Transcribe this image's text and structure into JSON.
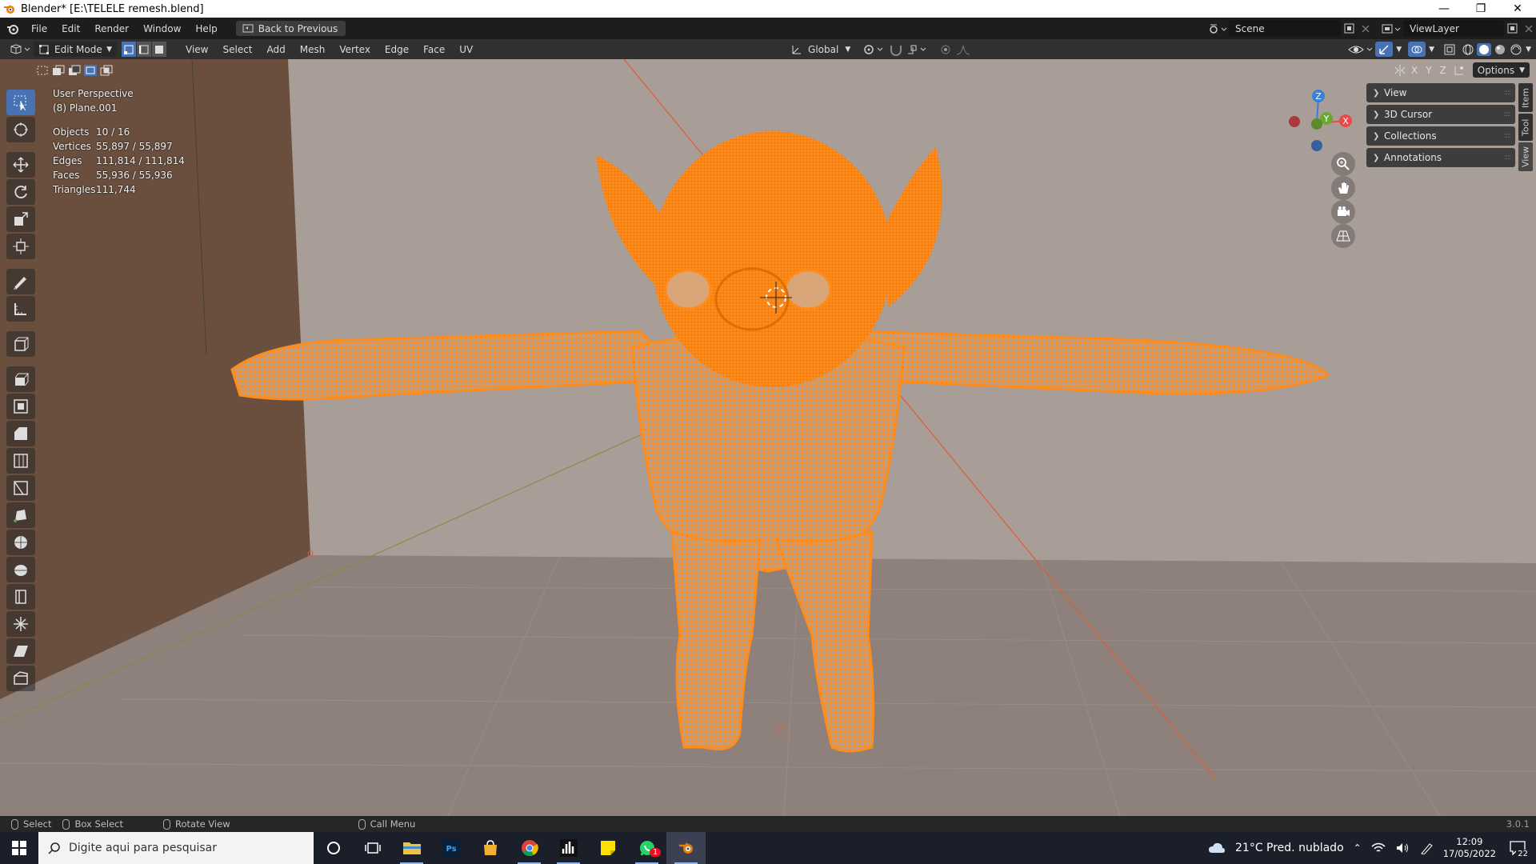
{
  "window": {
    "title": "Blender* [E:\\TELELE  remesh.blend]",
    "minimize": "—",
    "restore": "❐",
    "close": "✕"
  },
  "topbar": {
    "menus": [
      "File",
      "Edit",
      "Render",
      "Window",
      "Help"
    ],
    "back_button": "Back to Previous",
    "scene_label": "Scene",
    "viewlayer_label": "ViewLayer"
  },
  "header": {
    "mode": "Edit Mode",
    "menus": [
      "View",
      "Select",
      "Add",
      "Mesh",
      "Vertex",
      "Edge",
      "Face",
      "UV"
    ],
    "orientation": "Global",
    "options": "Options",
    "axes": [
      "X",
      "Y",
      "Z"
    ]
  },
  "stats": {
    "view": "User Perspective",
    "object": "(8) Plane.001",
    "rows": [
      {
        "label": "Objects",
        "value": "10 / 16"
      },
      {
        "label": "Vertices",
        "value": "55,897 / 55,897"
      },
      {
        "label": "Edges",
        "value": "111,814 / 111,814"
      },
      {
        "label": "Faces",
        "value": "55,936 / 55,936"
      },
      {
        "label": "Triangles",
        "value": "111,744"
      }
    ]
  },
  "gizmo": {
    "x": "X",
    "y": "Y",
    "z": "Z"
  },
  "npanel": {
    "items": [
      "View",
      "3D Cursor",
      "Collections",
      "Annotations"
    ],
    "tabs": [
      "Item",
      "Tool",
      "View"
    ]
  },
  "statusbar": {
    "select": "Select",
    "box_select": "Box Select",
    "rotate_view": "Rotate View",
    "call_menu": "Call Menu",
    "version": "3.0.1"
  },
  "taskbar": {
    "search_placeholder": "Digite aqui para pesquisar",
    "weather": "21°C  Pred. nublado",
    "time": "12:09",
    "date": "17/05/2022",
    "notifications": "22",
    "whatsapp_badge": "1"
  },
  "colors": {
    "selection": "#ff8c1a",
    "active_tool": "#4772b3",
    "x_axis": "#e84a4a",
    "y_axis": "#6aa832",
    "z_axis": "#3b7fd6"
  }
}
